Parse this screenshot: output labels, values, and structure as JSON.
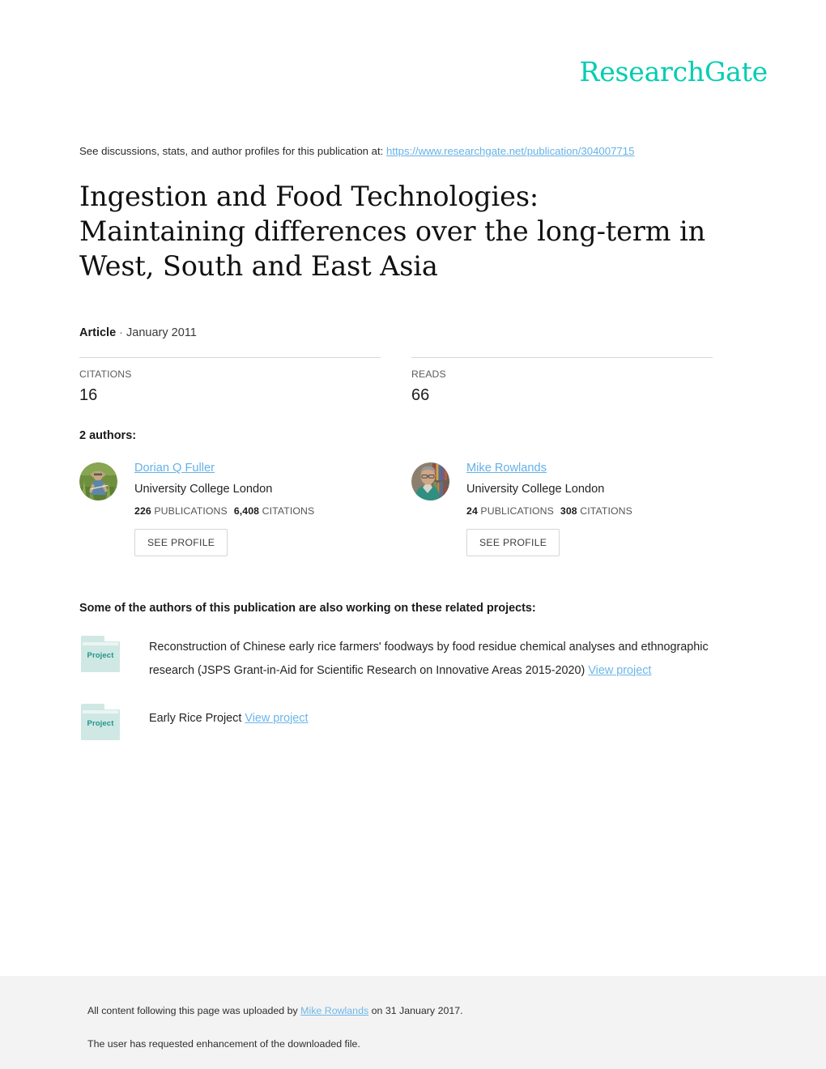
{
  "brand": {
    "logo_text": "ResearchGate",
    "logo_color": "#00cdb0",
    "link_color": "#66b2e8"
  },
  "discussion": {
    "prefix": "See discussions, stats, and author profiles for this publication at: ",
    "url": "https://www.researchgate.net/publication/304007715"
  },
  "publication": {
    "title": "Ingestion and Food Technologies: Maintaining differences over the long-term in West, South and East Asia",
    "type": "Article",
    "separator": " · ",
    "date": "January 2011"
  },
  "stats": {
    "citations": {
      "label": "CITATIONS",
      "value": "16"
    },
    "reads": {
      "label": "READS",
      "value": "66"
    }
  },
  "authors": {
    "heading": "2 authors:",
    "list": [
      {
        "name": "Dorian Q Fuller",
        "affiliation": "University College London",
        "publications_count": "226",
        "publications_label": "PUBLICATIONS",
        "citations_count": "6,408",
        "citations_label": "CITATIONS",
        "profile_button": "SEE PROFILE",
        "avatar_name": "author-avatar-fuller"
      },
      {
        "name": "Mike Rowlands",
        "affiliation": "University College London",
        "publications_count": "24",
        "publications_label": "PUBLICATIONS",
        "citations_count": "308",
        "citations_label": "CITATIONS",
        "profile_button": "SEE PROFILE",
        "avatar_name": "author-avatar-rowlands"
      }
    ]
  },
  "projects": {
    "heading": "Some of the authors of this publication are also working on these related projects:",
    "folder_label": "Project",
    "items": [
      {
        "title": "Reconstruction of Chinese early rice farmers' foodways by food residue chemical analyses and ethnographic research (JSPS Grant-in-Aid for Scientific Research on Innovative Areas 2015-2020) ",
        "link": "View project"
      },
      {
        "title": "Early Rice Project ",
        "link": "View project"
      }
    ]
  },
  "footer": {
    "upload_prefix": "All content following this page was uploaded by ",
    "upload_user": "Mike Rowlands",
    "upload_suffix": " on 31 January 2017.",
    "enhancement_note": "The user has requested enhancement of the downloaded file."
  }
}
